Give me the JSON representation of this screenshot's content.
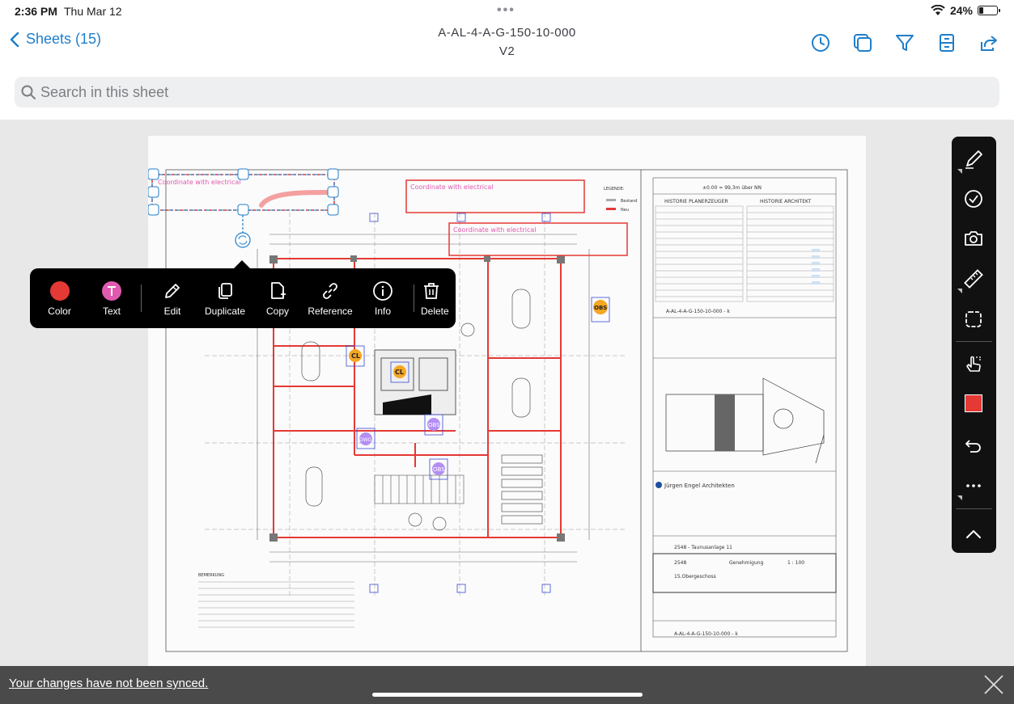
{
  "status": {
    "time": "2:36 PM",
    "date": "Thu Mar 12",
    "battery": "24%"
  },
  "nav": {
    "back_label": "Sheets (15)",
    "sheet_title": "A-AL-4-A-G-150-10-000",
    "version": "V2"
  },
  "search": {
    "placeholder": "Search in this sheet"
  },
  "markup": {
    "text": "Coordinate with electrical",
    "popup": {
      "color": "Color",
      "text": "Text",
      "edit": "Edit",
      "duplicate": "Duplicate",
      "copy": "Copy",
      "reference": "Reference",
      "info": "Info",
      "delete": "Delete"
    }
  },
  "sheet": {
    "legend_title": "LEGENDE:",
    "legend_items": [
      "Bestand",
      "Neu"
    ],
    "elevation": "±0.00  = 99,3m über NN",
    "history_planner": "HISTORIE PLANERZEUGER",
    "history_architect": "HISTORIE ARCHITEKT",
    "sheet_ref": "A-AL-4-A-G-150-10-000 - k",
    "architect": "Jürgen Engel Architekten",
    "project": "2548 - Taunusanlage 11",
    "project_no": "2548",
    "approval": "Genehmigung",
    "scale": "1 : 100",
    "floor": "15.Obergeschoss",
    "notes_title": "BEMERKUNG",
    "pins": [
      "CL",
      "CL",
      "OBS",
      "OBS",
      "OBS",
      "DWG"
    ]
  },
  "bottom": {
    "sync_message": "Your changes have not been synced."
  },
  "colors": {
    "accent": "#1f7ec9",
    "markup_red": "#e53935",
    "pin_orange": "#f5a623",
    "pin_purple": "#b38ef3"
  }
}
